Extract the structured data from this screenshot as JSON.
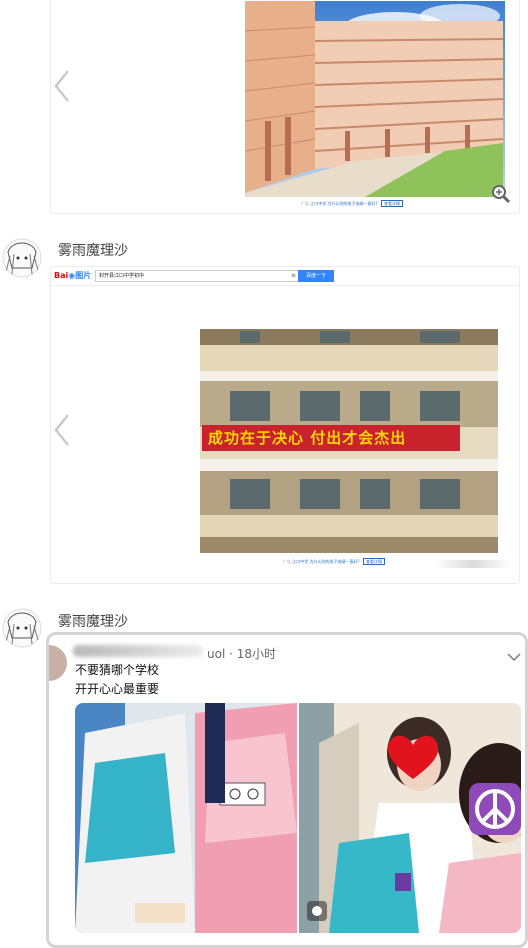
{
  "post1": {
    "ad_label": "广告",
    "ad_text": "江口中学 为什么别的孩子成绩一直好?",
    "ad_button": "查看详情"
  },
  "post2": {
    "username": "雾雨魔理沙",
    "baidu_logo_text": "Bai",
    "baidu_logo_suffix": "图片",
    "search_value": "封开县江口中学初中",
    "search_button": "百度一下",
    "banner_text": "成功在于决心 付出才会杰出",
    "ad_label": "广告",
    "ad_text": "江口中学 为什么别的孩子成绩一直好?",
    "ad_button": "查看详情"
  },
  "post3": {
    "username": "雾雨魔理沙",
    "tweet_handle_suffix": "uol · 18小时",
    "tweet_line1": "不要猜哪个学校",
    "tweet_line2": "开开心心最重要"
  },
  "colors": {
    "baidu_blue": "#3385ff",
    "baidu_red": "#e10601",
    "banner_red": "#c8232c",
    "banner_text": "#ffd700"
  }
}
